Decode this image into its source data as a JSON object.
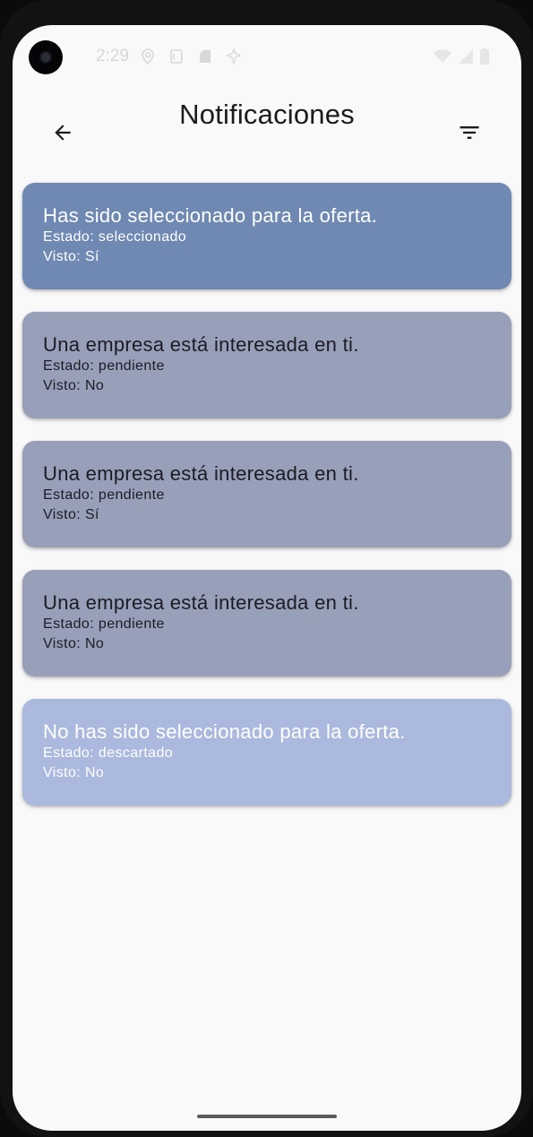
{
  "status_bar": {
    "time": "2:29",
    "icons": [
      "location-icon",
      "sim-icon",
      "sd-card-icon",
      "signal-app-icon",
      "wifi-icon",
      "cellular-icon",
      "battery-icon"
    ]
  },
  "app_bar": {
    "title": "Notificaciones",
    "back_icon": "arrow-back-icon",
    "filter_icon": "filter-icon"
  },
  "notifications": [
    {
      "title": "Has sido seleccionado para la oferta.",
      "estado": "Estado: seleccionado",
      "visto": "Visto: Sí",
      "bg": "#6f89b2",
      "fg": "#ffffff"
    },
    {
      "title": "Una empresa está interesada en ti.",
      "estado": "Estado: pendiente",
      "visto": "Visto: No",
      "bg": "#989fb9",
      "fg": "#1c1c24"
    },
    {
      "title": "Una empresa está interesada en ti.",
      "estado": "Estado: pendiente",
      "visto": "Visto: Sí",
      "bg": "#989fb9",
      "fg": "#1c1c24"
    },
    {
      "title": "Una empresa está interesada en ti.",
      "estado": "Estado: pendiente",
      "visto": "Visto: No",
      "bg": "#989fb9",
      "fg": "#1c1c24"
    },
    {
      "title": "No has sido seleccionado para la oferta.",
      "estado": "Estado: descartado",
      "visto": "Visto: No",
      "bg": "#aab9dd",
      "fg": "#ffffff"
    }
  ],
  "colors": {
    "background": "#f9f9f9",
    "title": "#1b1b1f"
  }
}
